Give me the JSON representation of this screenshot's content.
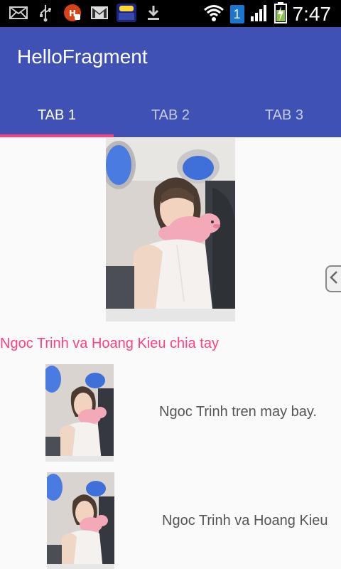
{
  "status_bar": {
    "time": "7:47",
    "sim_badge": "1",
    "notification_icons": [
      "mail-icon",
      "usb-icon",
      "app-icon",
      "gmail-icon",
      "toeic-icon",
      "download-icon"
    ],
    "system_icons": [
      "wifi-icon",
      "sim-badge",
      "signal-icon",
      "battery-charging-icon"
    ]
  },
  "app": {
    "title": "HelloFragment",
    "accent_color": "#ff4081",
    "primary_color": "#3f51b5"
  },
  "tabs": [
    {
      "label": "TAB 1",
      "active": true
    },
    {
      "label": "TAB 2",
      "active": false
    },
    {
      "label": "TAB 3",
      "active": false
    }
  ],
  "feature": {
    "headline": "Ngoc Trinh va Hoang Kieu chia tay"
  },
  "list_items": [
    {
      "text": "Ngoc Trinh tren may bay."
    },
    {
      "text": "Ngoc Trinh va Hoang Kieu"
    }
  ]
}
